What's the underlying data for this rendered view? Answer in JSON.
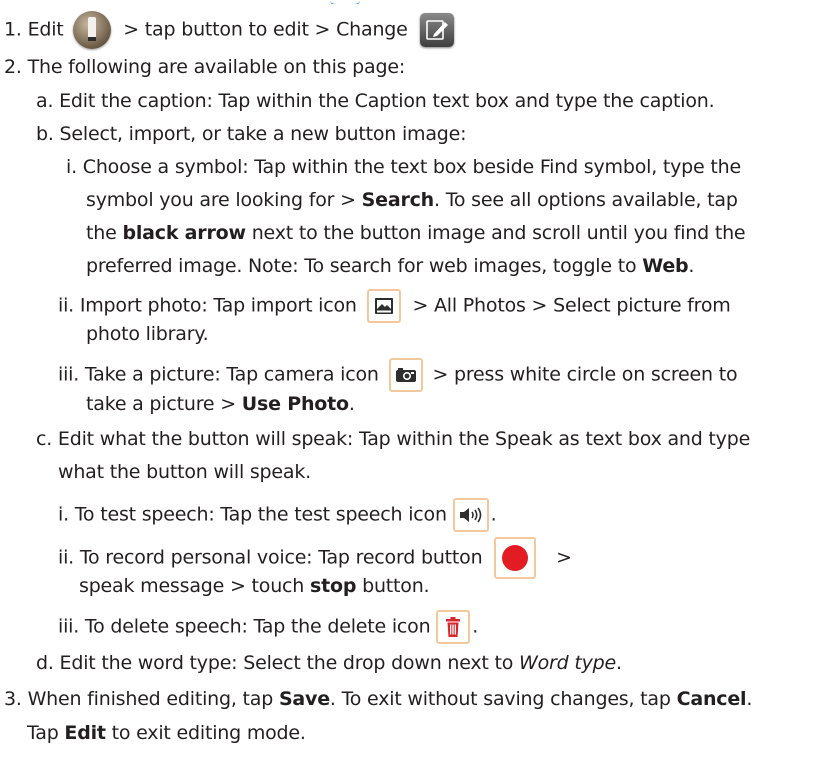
{
  "steps": {
    "s1_a": "1. Edit",
    "s1_b": "> tap button to edit > Change",
    "s2": "2. The following are available on this page:",
    "s2a": "a. Edit the caption: Tap within the Caption text box and type the caption.",
    "s2b": "b. Select, import, or take a new button image:",
    "s2bi_1": "i. Choose a symbol: Tap within the text box beside Find symbol, type the",
    "s2bi_2a": "symbol you are looking for >",
    "s2bi_2b": "Search",
    "s2bi_2c": ".  To see all options available, tap",
    "s2bi_3a": "the",
    "s2bi_3b": "black arrow",
    "s2bi_3c": "next to the button image and scroll until you find the",
    "s2bi_4a": "preferred image.  Note: To search for web images, toggle to",
    "s2bi_4b": "Web",
    "s2bi_4c": ".",
    "s2bii_1a": "ii. Import photo: Tap import icon",
    "s2bii_1b": "> All Photos > Select picture from",
    "s2bii_2": "photo library.",
    "s2biii_1a": "iii. Take a picture: Tap camera icon",
    "s2biii_1b": "> press white circle on screen to",
    "s2biii_2a": "take a picture >",
    "s2biii_2b": "Use Photo",
    "s2biii_2c": ".",
    "s2c_1": "c. Edit what the button will speak: Tap within the Speak as text box and type",
    "s2c_2": "what the button will speak.",
    "s2ci_a": "i. To test speech: Tap the test speech icon",
    "s2ci_b": ".",
    "s2cii_1a": "ii. To record personal voice: Tap record button",
    "s2cii_1b": ">",
    "s2cii_2a": "speak message > touch",
    "s2cii_2b": "stop",
    "s2cii_2c": "button.",
    "s2ciii_a": "iii.  To delete speech: Tap the delete icon",
    "s2ciii_b": ".",
    "s2d_a": "d. Edit the word type:  Select the drop down next to",
    "s2d_b": "Word type",
    "s2d_c": ".",
    "s3_1a": "3. When finished editing, tap",
    "s3_1b": "Save",
    "s3_1c": ". To exit without saving changes, tap",
    "s3_1d": "Cancel",
    "s3_1e": ".",
    "s3_2a": "Tap",
    "s3_2b": "Edit",
    "s3_2c": "to exit editing mode."
  },
  "icons": {
    "edit": "edit-tool-icon",
    "change": "change-image-icon",
    "import": "import-photo-icon",
    "camera": "camera-icon",
    "speaker": "test-speech-icon",
    "record": "record-icon",
    "delete": "delete-icon"
  },
  "colors": {
    "text": "#231f20",
    "icon_border": "#f3c89d",
    "record_red": "#e31b23",
    "delete_red": "#d7262e",
    "icon_dark": "#2e2e2e"
  }
}
